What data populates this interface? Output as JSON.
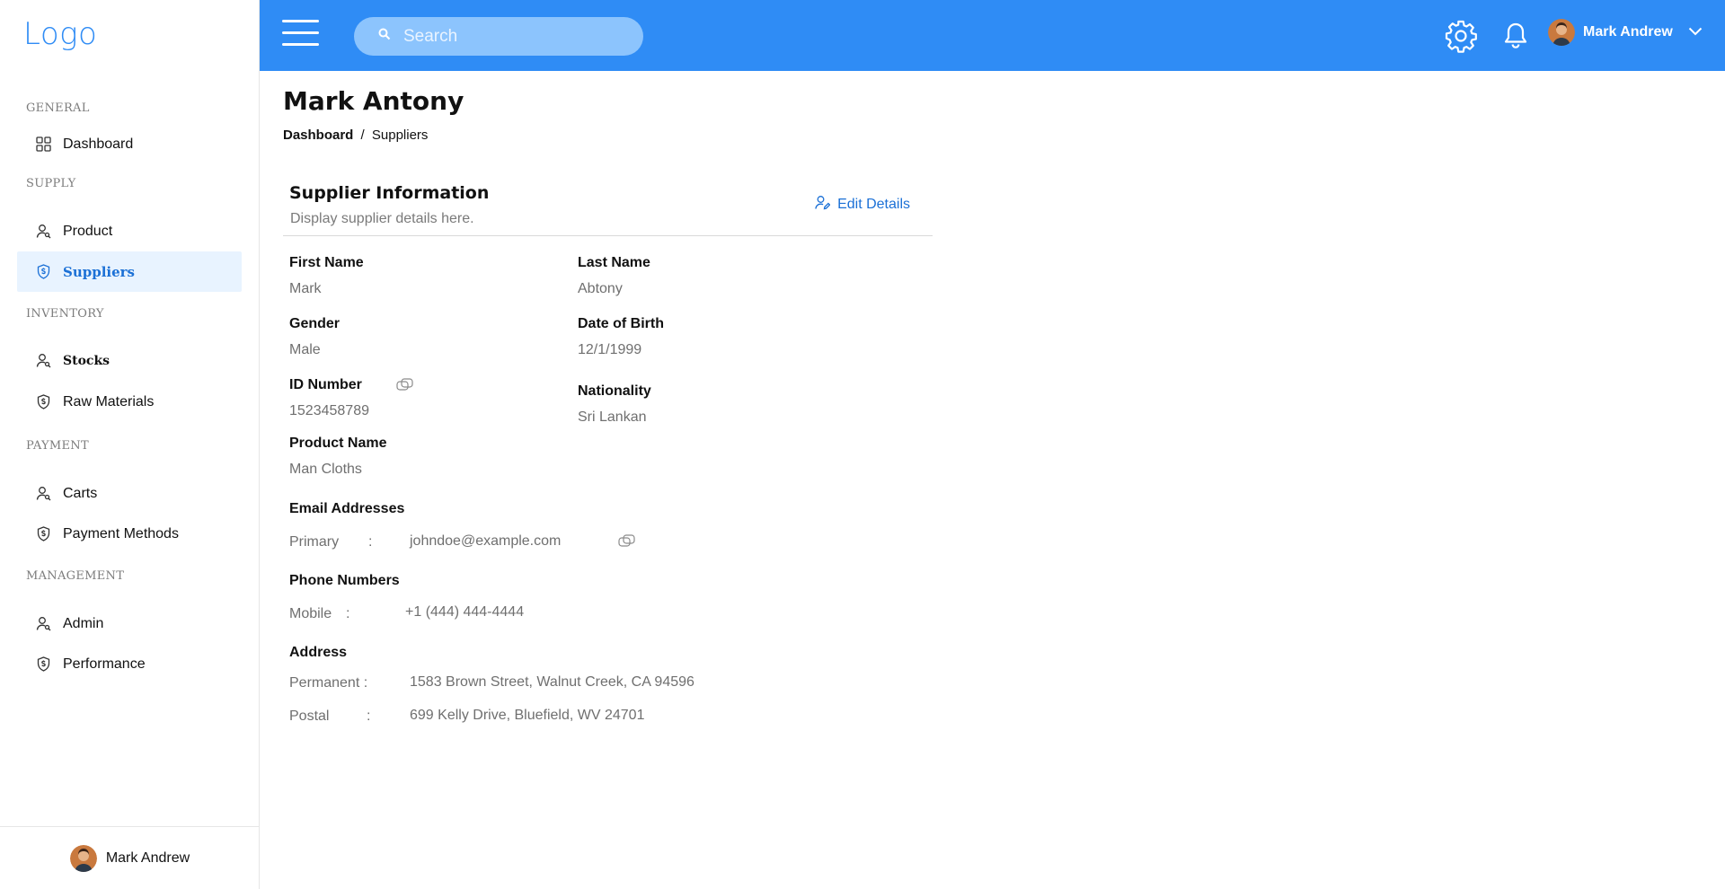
{
  "sidebar": {
    "logo": "Logo",
    "sections": {
      "general": "GENERAL",
      "supply": "SUPPLY",
      "inventory": "INVENTORY",
      "payment": "PAYMENT",
      "management": "MANAGEMENT"
    },
    "items": {
      "dashboard": "Dashboard",
      "product": "Product",
      "suppliers": "Suppliers",
      "stocks": "Stocks",
      "raw_materials": "Raw Materials",
      "carts": "Carts",
      "payment_methods": "Payment Methods",
      "admin": "Admin",
      "performance": "Performance"
    },
    "active_item": "Suppliers",
    "footer_user": "Mark Andrew"
  },
  "topbar": {
    "search_placeholder": "Search",
    "user_name": "Mark Andrew",
    "background_color": "#2f8cf5"
  },
  "page": {
    "title": "Mark Antony",
    "breadcrumb": {
      "root": "Dashboard",
      "separator": "/",
      "current": "Suppliers"
    }
  },
  "supplier": {
    "header_title": "Supplier Information",
    "header_subtitle": "Display supplier details here.",
    "edit_label": "Edit Details",
    "first_name_label": "First Name",
    "first_name": "Mark",
    "last_name_label": "Last Name",
    "last_name": "Abtony",
    "gender_label": "Gender",
    "gender": "Male",
    "dob_label": "Date of Birth",
    "dob": "12/1/1999",
    "id_label": "ID Number",
    "id_number": "1523458789",
    "nationality_label": "Nationality",
    "nationality": "Sri Lankan",
    "product_label": "Product Name",
    "product_name": "Man Cloths",
    "email_section": "Email Addresses",
    "email_primary_label": "Primary",
    "email_primary": "johndoe@example.com",
    "phone_section": "Phone Numbers",
    "phone_mobile_label": "Mobile",
    "phone_mobile": "+1 (444) 444-4444",
    "address_section": "Address",
    "address_permanent_label": "Permanent :",
    "address_permanent": "1583 Brown Street, Walnut Creek, CA 94596",
    "address_postal_label": "Postal",
    "address_postal": "699 Kelly Drive, Bluefield, WV 24701",
    "colon": ":"
  },
  "colors": {
    "accent": "#2f8cf5",
    "active_bg": "#e8f3ff",
    "active_text": "#1b70d6"
  }
}
